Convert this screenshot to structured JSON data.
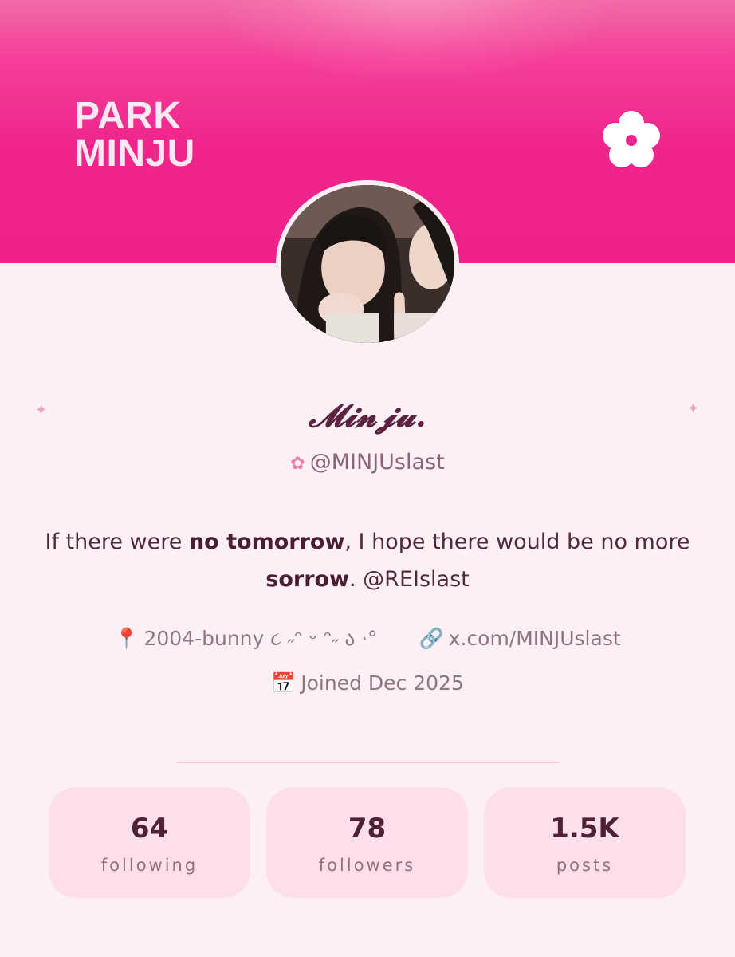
{
  "banner": {
    "title_line1": "PARK",
    "title_line2": "MINJU",
    "icon": "flower-icon"
  },
  "profile": {
    "display_name": "𝓜𝓲𝓷𝓳𝓾.",
    "handle": "@MINJUslast",
    "handle_icon": "flower-small-icon",
    "bio": {
      "part1": "If there were ",
      "bold1": "no tomorrow",
      "part2": ", I hope there would be no more ",
      "bold2": "sorrow",
      "part3": ". @REIslast"
    },
    "location": "2004-bunny ૮ ˶ᵔ ᵕ ᵔ˶ ა ·°",
    "location_icon": "pin-icon",
    "link": "x.com/MINJUslast",
    "link_icon": "link-icon",
    "joined": "Joined Dec 2025",
    "joined_icon": "calendar-icon"
  },
  "stats": [
    {
      "value": "64",
      "label": "following"
    },
    {
      "value": "78",
      "label": "followers"
    },
    {
      "value": "1.5K",
      "label": "posts"
    }
  ],
  "colors": {
    "banner": "#ee228a",
    "background": "#fdf0f5",
    "card": "#fcdfea",
    "text": "#4f2a3c"
  }
}
